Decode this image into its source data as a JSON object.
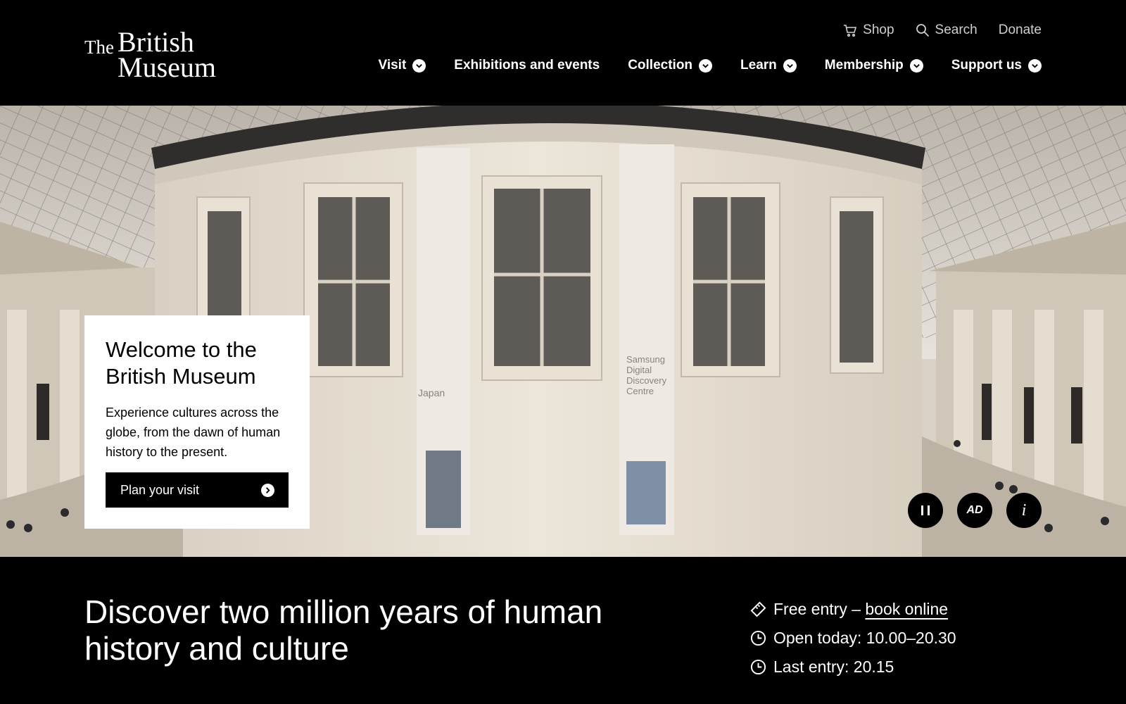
{
  "logo": {
    "the": "The",
    "british": "British",
    "museum": "Museum"
  },
  "utility_nav": {
    "shop": "Shop",
    "search": "Search",
    "donate": "Donate"
  },
  "main_nav": [
    {
      "label": "Visit",
      "dropdown": true
    },
    {
      "label": "Exhibitions and events",
      "dropdown": false
    },
    {
      "label": "Collection",
      "dropdown": true
    },
    {
      "label": "Learn",
      "dropdown": true
    },
    {
      "label": "Membership",
      "dropdown": true
    },
    {
      "label": "Support us",
      "dropdown": true
    }
  ],
  "hero": {
    "welcome_title": "Welcome to the British Museum",
    "welcome_text": "Experience cultures across the globe, from the dawn of human history to the present.",
    "cta_label": "Plan your visit",
    "banner_japan": "Japan",
    "banner_samsung": "Samsung Digital Discovery Centre",
    "controls": {
      "pause_icon": "pause-icon",
      "ad_label": "AD",
      "info_label": "i"
    }
  },
  "info": {
    "tagline": "Discover two million years of human history and culture",
    "free_entry_prefix": "Free entry – ",
    "book_online": "book online",
    "open_today": "Open today: 10.00–20.30",
    "last_entry": "Last entry: 20.15"
  },
  "colors": {
    "background": "#000000",
    "panel": "#ffffff",
    "hero_stone": "#e2dccf"
  }
}
